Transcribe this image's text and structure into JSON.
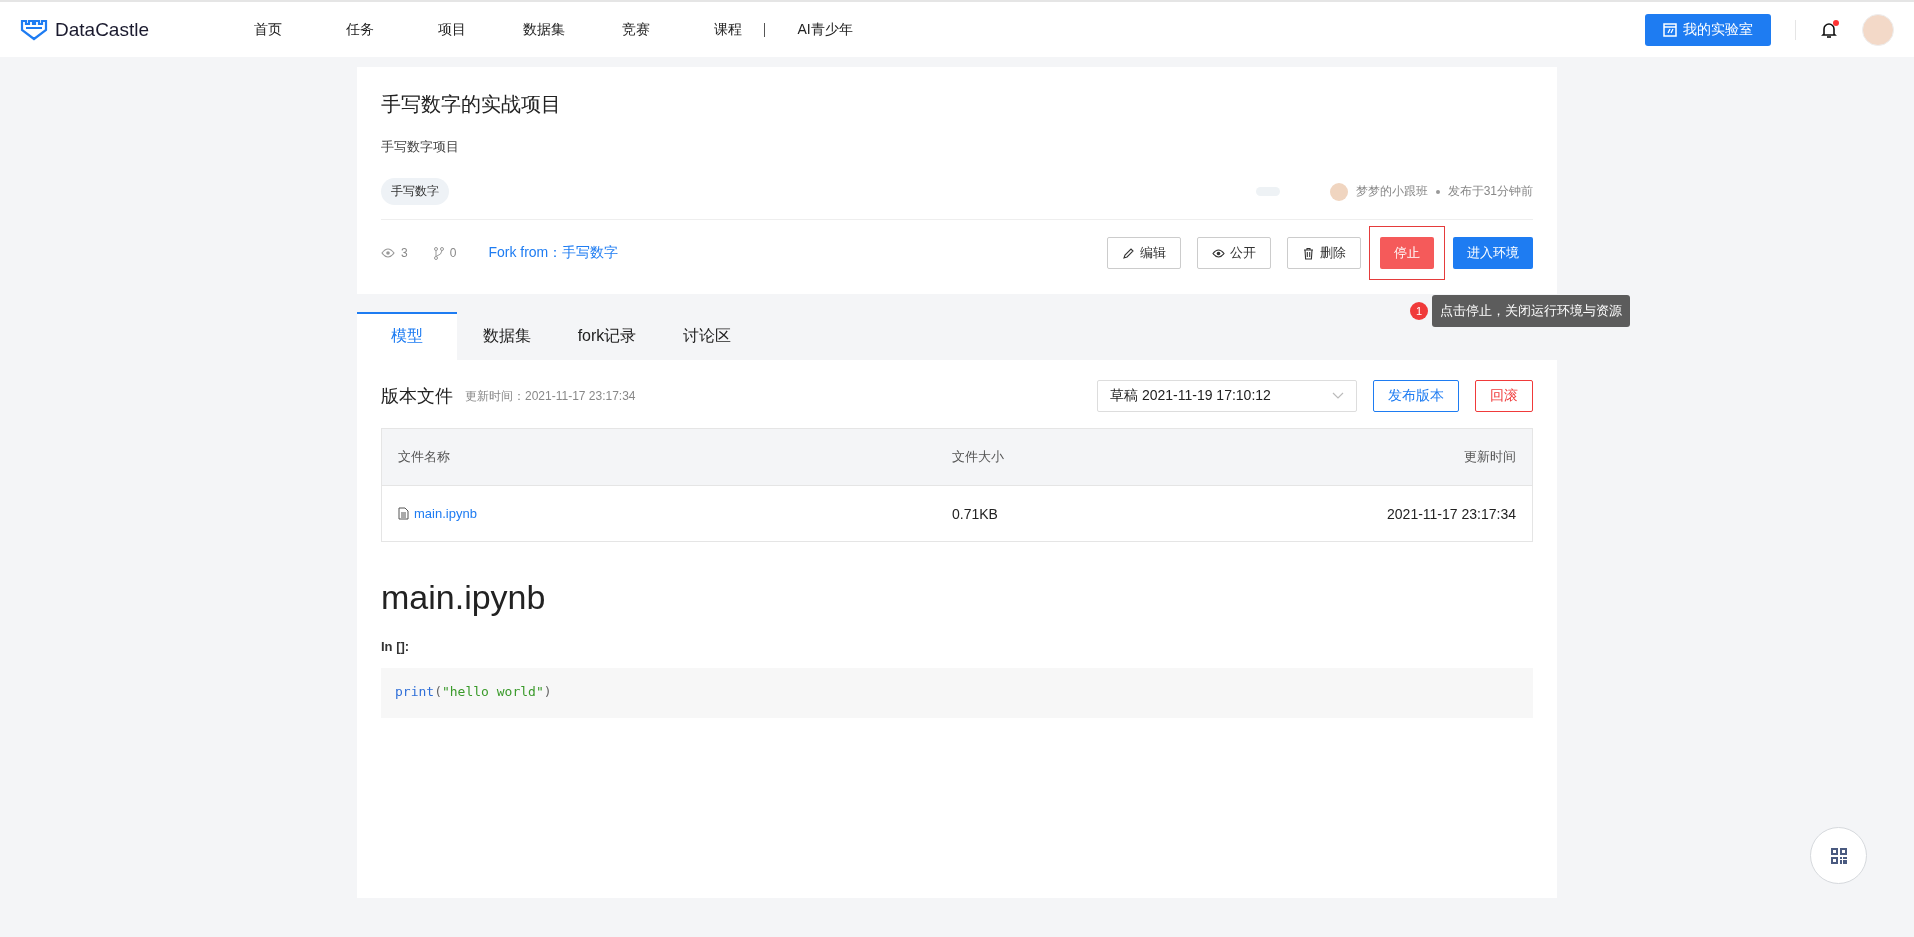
{
  "header": {
    "logo": "DataCastle",
    "nav": [
      {
        "label": "首页",
        "selected": false
      },
      {
        "label": "任务",
        "selected": false
      },
      {
        "label": "项目",
        "selected": false
      },
      {
        "label": "数据集",
        "selected": false
      },
      {
        "label": "竞赛",
        "selected": false
      },
      {
        "label": "课程",
        "selected": false
      },
      {
        "label": "AI青少年",
        "selected": false
      }
    ],
    "lab_button": "我的实验室",
    "notification": true
  },
  "project": {
    "title": "手写数字的实战项目",
    "subtitle": "手写数字项目",
    "tag": "手写数字",
    "author": "梦梦的小跟班",
    "published": "发布于31分钟前",
    "views": "3",
    "forks": "0",
    "fork_from_label": "Fork from：",
    "fork_from": "手写数字",
    "actions": [
      {
        "kind": "edit",
        "label": "编辑"
      },
      {
        "kind": "visibility",
        "label": "公开"
      },
      {
        "kind": "delete",
        "label": "删除"
      },
      {
        "kind": "stop",
        "label": "停止",
        "highlighted": true
      },
      {
        "kind": "enter",
        "label": "进入环境"
      }
    ],
    "guide": {
      "step": "1",
      "text": "点击停止，关闭运行环境与资源"
    }
  },
  "tabs": [
    {
      "label": "模型",
      "selected": true
    },
    {
      "label": "数据集",
      "selected": false
    },
    {
      "label": "fork记录",
      "selected": false
    },
    {
      "label": "讨论区",
      "selected": false
    }
  ],
  "files": {
    "heading": "版本文件",
    "updated_label": "更新时间：",
    "updated": "2021-11-17 23:17:34",
    "version": "草稿 2021-11-19 17:10:12",
    "publish_button": "发布版本",
    "rollback_button": "回滚",
    "columns": [
      "文件名称",
      "文件大小",
      "更新时间"
    ],
    "rows": [
      {
        "name": "main.ipynb",
        "size": "0.71KB",
        "time": "2021-11-17 23:17:34"
      }
    ]
  },
  "notebook": {
    "title": "main.ipynb",
    "prompt": "In []:",
    "code": [
      {
        "kind": "builtin",
        "text": "print"
      },
      {
        "kind": "punct",
        "text": "("
      },
      {
        "kind": "string",
        "text": "\"hello world\""
      },
      {
        "kind": "punct",
        "text": ")"
      }
    ]
  }
}
